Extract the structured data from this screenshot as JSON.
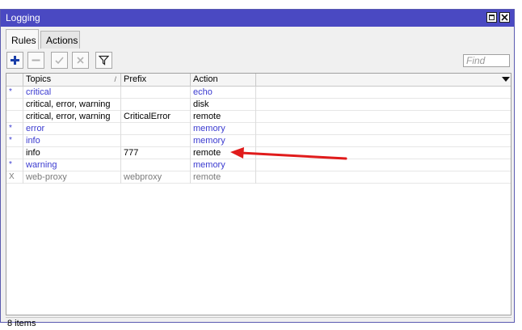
{
  "window": {
    "title": "Logging"
  },
  "tabs": [
    {
      "label": "Rules",
      "active": true
    },
    {
      "label": "Actions",
      "active": false
    }
  ],
  "toolbar": {
    "add_icon": "plus-icon",
    "remove_icon": "minus-icon",
    "enable_icon": "check-icon",
    "disable_icon": "cross-icon",
    "filter_icon": "filter-icon",
    "find_placeholder": "Find"
  },
  "table": {
    "columns": [
      "",
      "Topics",
      "Prefix",
      "Action"
    ],
    "rows": [
      {
        "flag": "*",
        "topics": "critical",
        "prefix": "",
        "action": "echo",
        "style": "blue"
      },
      {
        "flag": "",
        "topics": "critical, error, warning",
        "prefix": "",
        "action": "disk",
        "style": "normal"
      },
      {
        "flag": "",
        "topics": "critical, error, warning",
        "prefix": "CriticalError",
        "action": "remote",
        "style": "normal"
      },
      {
        "flag": "*",
        "topics": "error",
        "prefix": "",
        "action": "memory",
        "style": "blue"
      },
      {
        "flag": "*",
        "topics": "info",
        "prefix": "",
        "action": "memory",
        "style": "blue"
      },
      {
        "flag": "",
        "topics": "info",
        "prefix": "777",
        "action": "remote",
        "style": "normal"
      },
      {
        "flag": "*",
        "topics": "warning",
        "prefix": "",
        "action": "memory",
        "style": "blue"
      },
      {
        "flag": "X",
        "topics": "web-proxy",
        "prefix": "webproxy",
        "action": "remote",
        "style": "disabled"
      }
    ]
  },
  "status": {
    "items_count": "8 items"
  },
  "colors": {
    "titlebar": "#4a49c2",
    "dynamic_text": "#3b3bd0",
    "disabled_text": "#7a7a7a",
    "annotation_arrow": "#e01b1b"
  }
}
